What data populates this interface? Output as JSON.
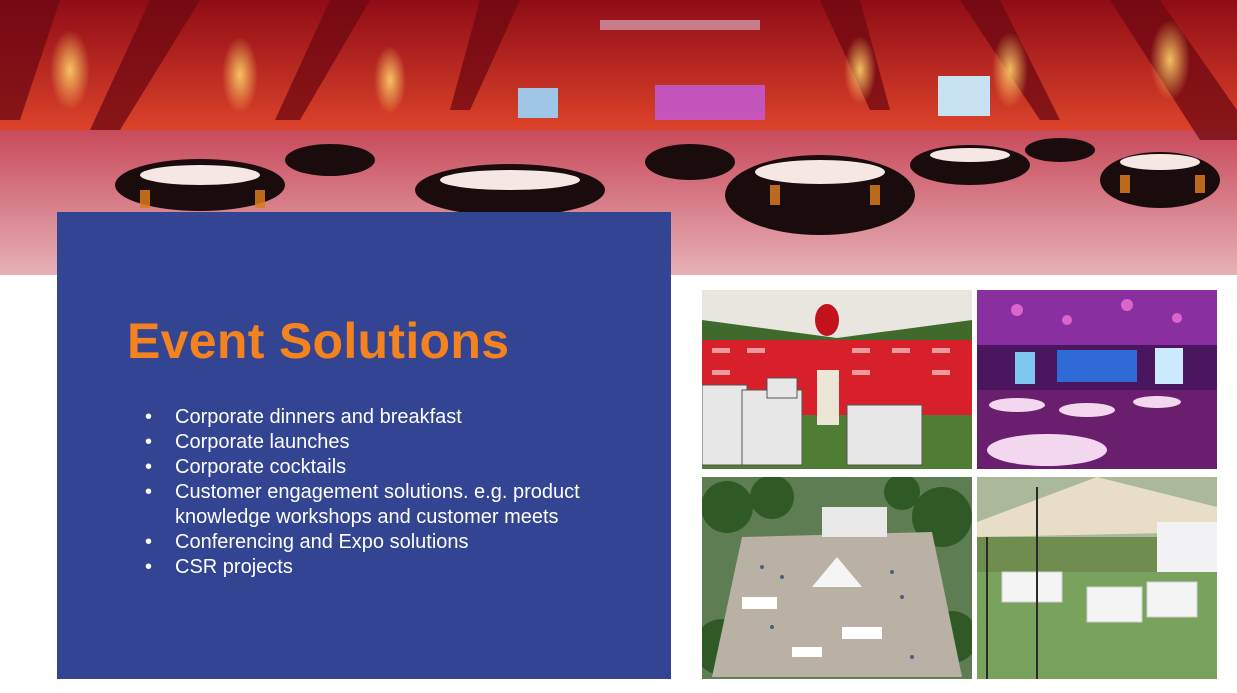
{
  "slide": {
    "title": "Event Solutions",
    "bullets": [
      "Corporate dinners and breakfast",
      "Corporate launches",
      "Corporate cocktails",
      "Customer engagement solutions. e.g. product knowledge workshops and customer meets",
      "Conferencing and Expo solutions",
      "CSR projects"
    ]
  },
  "colors": {
    "panel": "#334592",
    "title": "#f4821f",
    "text": "#ffffff"
  },
  "images": {
    "banner": "banquet-hall-photo",
    "photo1": "outdoor-branded-tent-event-photo",
    "photo2": "conference-stage-purple-lighting-photo",
    "photo3": "aerial-outdoor-festival-photo",
    "photo4": "outdoor-lounge-tent-photo"
  }
}
